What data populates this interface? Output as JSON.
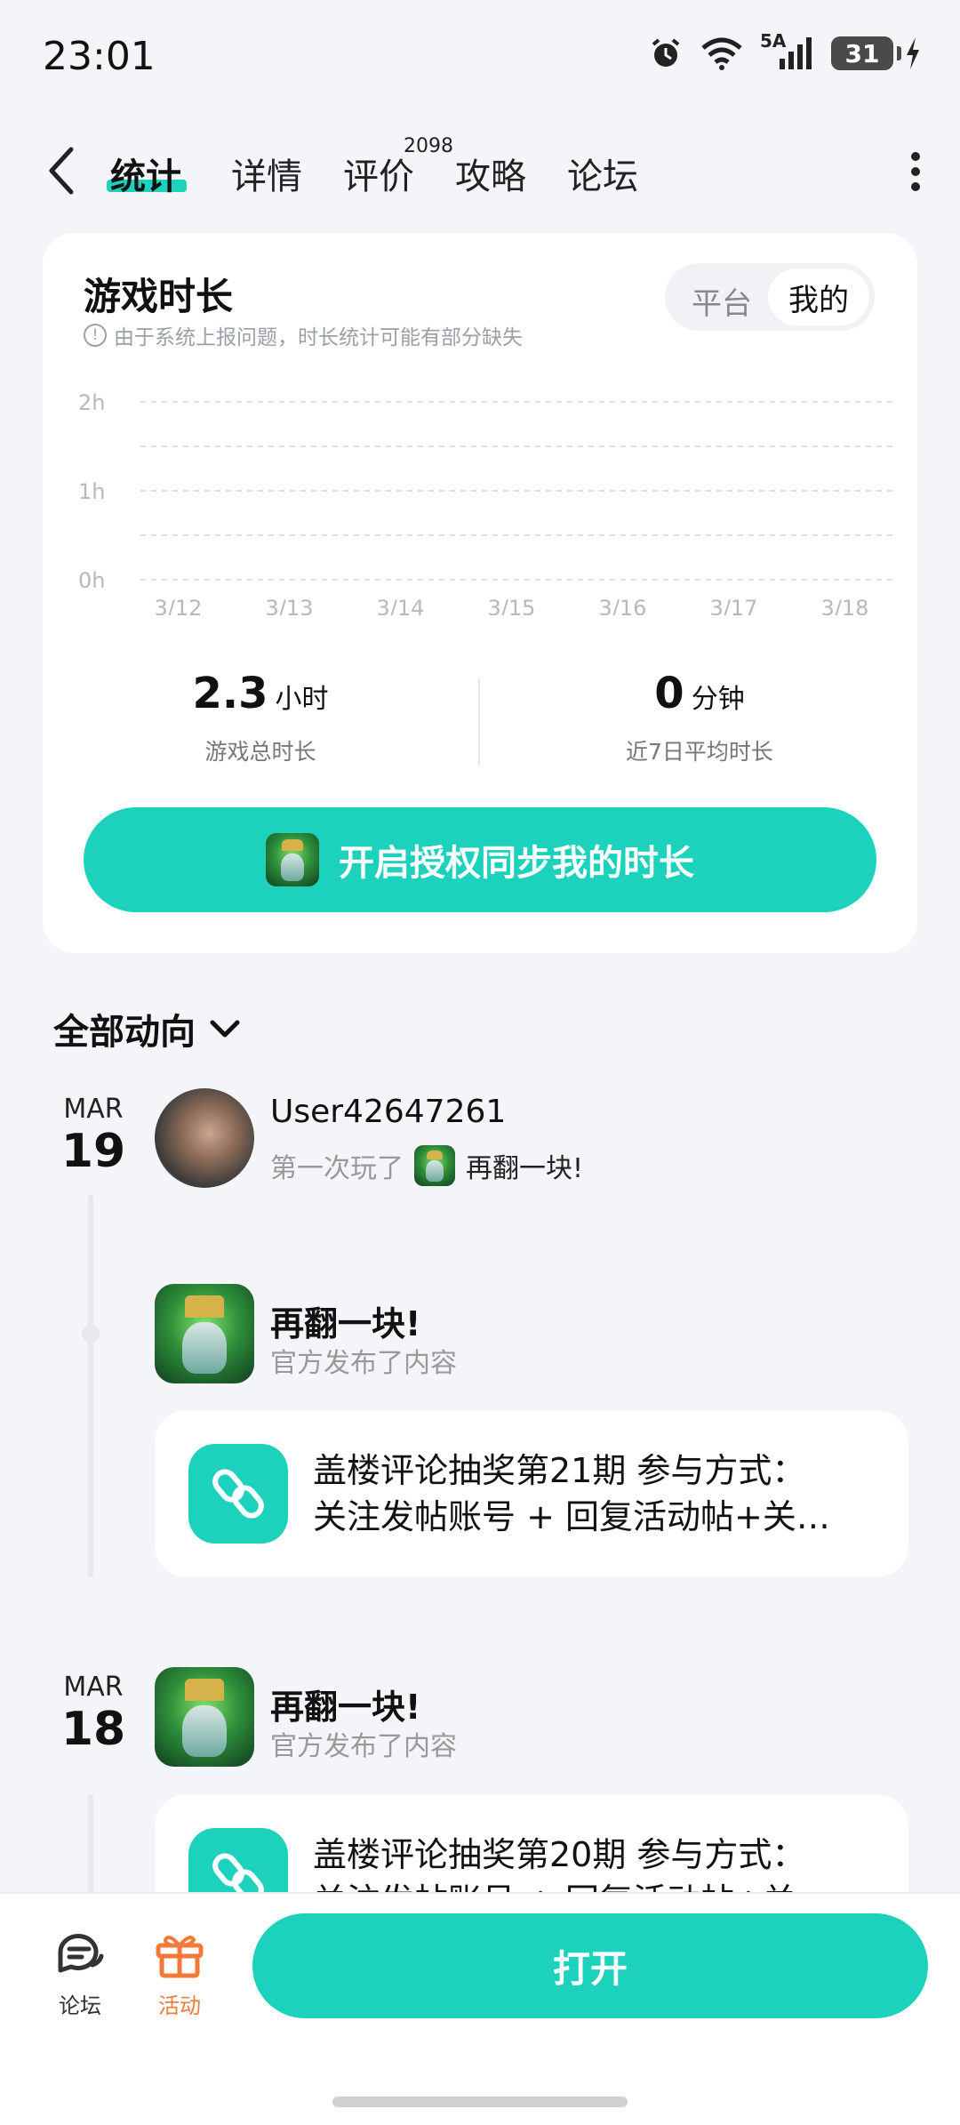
{
  "status_bar": {
    "time": "23:01",
    "network": "5A",
    "battery": "31"
  },
  "nav": {
    "tabs": [
      {
        "label": "统计",
        "active": true
      },
      {
        "label": "详情"
      },
      {
        "label": "评价",
        "badge": "2098"
      },
      {
        "label": "攻略"
      },
      {
        "label": "论坛"
      }
    ]
  },
  "playtime_card": {
    "title": "游戏时长",
    "note": "由于系统上报问题，时长统计可能有部分缺失",
    "segment": {
      "options": [
        "平台",
        "我的"
      ],
      "selected": "我的"
    },
    "total": {
      "value": "2.3",
      "unit": "小时",
      "label": "游戏总时长"
    },
    "average": {
      "value": "0",
      "unit": "分钟",
      "label": "近7日平均时长"
    },
    "cta_label": "开启授权同步我的时长"
  },
  "chart_data": {
    "type": "bar",
    "categories": [
      "3/12",
      "3/13",
      "3/14",
      "3/15",
      "3/16",
      "3/17",
      "3/18"
    ],
    "values": [
      0,
      0,
      0,
      0,
      0,
      0,
      0
    ],
    "y_ticks": [
      "2h",
      "1h",
      "0h"
    ],
    "ylim": [
      0,
      2
    ],
    "grid": true,
    "grid_style": "dashed",
    "accent_color": "#1dd2bd"
  },
  "feed": {
    "section_title": "全部动向",
    "groups": [
      {
        "month": "MAR",
        "day": "19",
        "user_event": {
          "username": "User42647261",
          "action": "第一次玩了",
          "game": "再翻一块!"
        },
        "official_post": {
          "game": "再翻一块!",
          "subtitle": "官方发布了内容",
          "line1": "盖楼评论抽奖第21期 参与方式：",
          "line2": "关注发帖账号 + 回复活动帖+关…"
        }
      },
      {
        "month": "MAR",
        "day": "18",
        "official_post": {
          "game": "再翻一块!",
          "subtitle": "官方发布了内容",
          "line1": "盖楼评论抽奖第20期 参与方式：",
          "line2": "关注发帖账号 + 回复活动帖+关…"
        }
      }
    ]
  },
  "bottom_bar": {
    "forum_label": "论坛",
    "events_label": "活动",
    "open_label": "打开",
    "events_color": "#f07a3a"
  },
  "colors": {
    "accent": "#1dd2bd",
    "background": "#f3f5f8"
  }
}
